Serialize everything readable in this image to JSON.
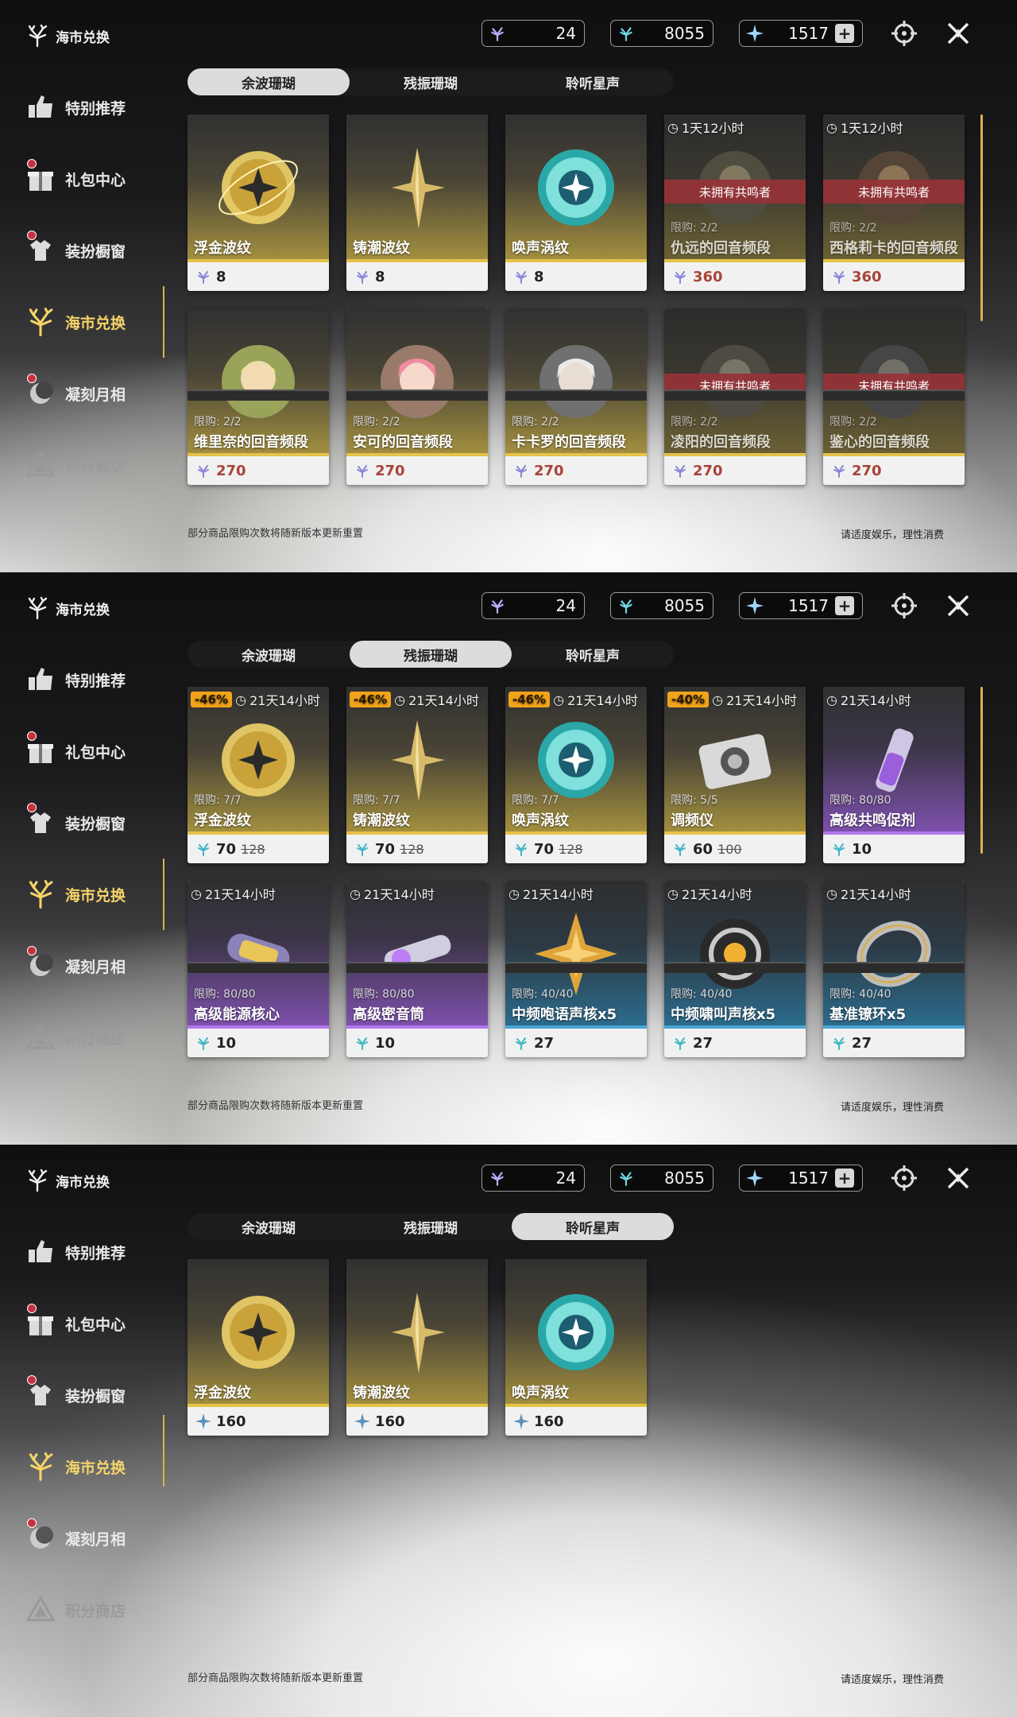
{
  "header": {
    "title": "海市兑换"
  },
  "sidebar": {
    "items": [
      {
        "label": "特别推荐",
        "icon": "thumbs-up-icon"
      },
      {
        "label": "礼包中心",
        "icon": "gift-icon"
      },
      {
        "label": "装扮橱窗",
        "icon": "outfit-icon"
      },
      {
        "label": "海市兑换",
        "icon": "coral-icon"
      },
      {
        "label": "凝刻月相",
        "icon": "moon-icon"
      },
      {
        "label": "积分商店",
        "icon": "triangle-shop-icon"
      }
    ]
  },
  "currency": {
    "afterglow": "24",
    "oscillate": "8055",
    "lunite": "1517"
  },
  "tabs": [
    "余波珊瑚",
    "残振珊瑚",
    "聆听星声"
  ],
  "footer": {
    "note": "部分商品限购次数将随新版本更新重置",
    "right": "请适度娱乐，理性消费"
  },
  "panel1": {
    "row1": [
      {
        "name": "浮金波纹",
        "price": "8"
      },
      {
        "name": "铸潮波纹",
        "price": "8"
      },
      {
        "name": "唤声涡纹",
        "price": "8"
      },
      {
        "timer": "1天12小时",
        "banner": "未拥有共鸣者",
        "limit": "限购: 2/2",
        "name": "仇远的回音频段",
        "price": "360"
      },
      {
        "timer": "1天12小时",
        "banner": "未拥有共鸣者",
        "limit": "限购: 2/2",
        "name": "西格莉卡的回音频段",
        "price": "360"
      }
    ],
    "row2": [
      {
        "limit": "限购: 2/2",
        "name": "维里奈的回音频段",
        "price": "270"
      },
      {
        "limit": "限购: 2/2",
        "name": "安可的回音频段",
        "price": "270"
      },
      {
        "limit": "限购: 2/2",
        "name": "卡卡罗的回音频段",
        "price": "270"
      },
      {
        "banner": "未拥有共鸣者",
        "limit": "限购: 2/2",
        "name": "凌阳的回音频段",
        "price": "270"
      },
      {
        "banner": "未拥有共鸣者",
        "limit": "限购: 2/2",
        "name": "鉴心的回音频段",
        "price": "270"
      }
    ]
  },
  "panel2": {
    "row1": [
      {
        "discount": "-46%",
        "timer": "21天14小时",
        "limit": "限购: 7/7",
        "name": "浮金波纹",
        "price": "70",
        "old": "128"
      },
      {
        "discount": "-46%",
        "timer": "21天14小时",
        "limit": "限购: 7/7",
        "name": "铸潮波纹",
        "price": "70",
        "old": "128"
      },
      {
        "discount": "-46%",
        "timer": "21天14小时",
        "limit": "限购: 7/7",
        "name": "唤声涡纹",
        "price": "70",
        "old": "128"
      },
      {
        "discount": "-40%",
        "timer": "21天14小时",
        "limit": "限购: 5/5",
        "name": "调频仪",
        "price": "60",
        "old": "100"
      },
      {
        "timer": "21天14小时",
        "limit": "限购: 80/80",
        "name": "高级共鸣促剂",
        "price": "10"
      }
    ],
    "row2": [
      {
        "timer": "21天14小时",
        "limit": "限购: 80/80",
        "name": "高级能源核心",
        "price": "10"
      },
      {
        "timer": "21天14小时",
        "limit": "限购: 80/80",
        "name": "高级密音筒",
        "price": "10"
      },
      {
        "timer": "21天14小时",
        "limit": "限购: 40/40",
        "name": "中频咆语声核x5",
        "price": "27"
      },
      {
        "timer": "21天14小时",
        "limit": "限购: 40/40",
        "name": "中频啸叫声核x5",
        "price": "27"
      },
      {
        "timer": "21天14小时",
        "limit": "限购: 40/40",
        "name": "基准镣环x5",
        "price": "27"
      }
    ]
  },
  "panel3": {
    "row1": [
      {
        "name": "浮金波纹",
        "price": "160"
      },
      {
        "name": "铸潮波纹",
        "price": "160"
      },
      {
        "name": "唤声涡纹",
        "price": "160"
      }
    ]
  }
}
